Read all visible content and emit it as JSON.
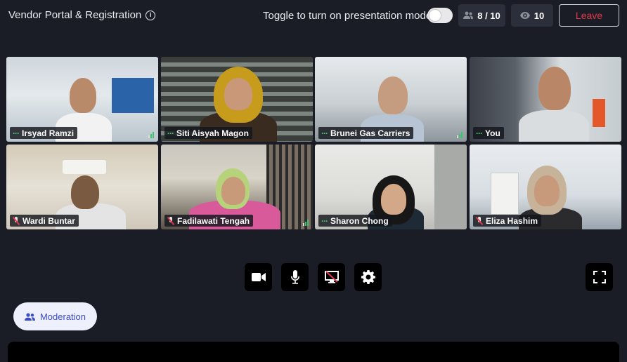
{
  "header": {
    "title": "Vendor Portal & Registration",
    "info_icon": "info-icon",
    "toggle_label": "Toggle to turn on presentation mode",
    "presentation_mode": false,
    "participants_count": "8 / 10",
    "viewers_count": "10",
    "leave_label": "Leave"
  },
  "participants": [
    {
      "name": "Irsyad Ramzi",
      "status": "speaking-dots",
      "signal": true
    },
    {
      "name": "Siti Aisyah Magon",
      "status": "speaking-dots",
      "signal": false
    },
    {
      "name": "Brunei Gas Carriers",
      "status": "speaking-dots",
      "signal": true
    },
    {
      "name": "You",
      "status": "speaking-dots",
      "signal": false
    },
    {
      "name": "Wardi Buntar",
      "status": "muted",
      "signal": false
    },
    {
      "name": "Fadilawati Tengah",
      "status": "muted",
      "signal": true
    },
    {
      "name": "Sharon Chong",
      "status": "speaking-dots",
      "signal": false
    },
    {
      "name": "Eliza Hashim",
      "status": "muted",
      "signal": false
    }
  ],
  "controls": {
    "camera": "video-camera-icon",
    "mic": "microphone-icon",
    "screen_share": "screen-share-off-icon",
    "settings": "gear-icon",
    "fullscreen": "fullscreen-icon"
  },
  "moderation": {
    "label": "Moderation"
  },
  "colors": {
    "background": "#1a1d26",
    "accent": "#3b4cca",
    "leave": "#e0384a",
    "speaking": "#3ec46d"
  }
}
